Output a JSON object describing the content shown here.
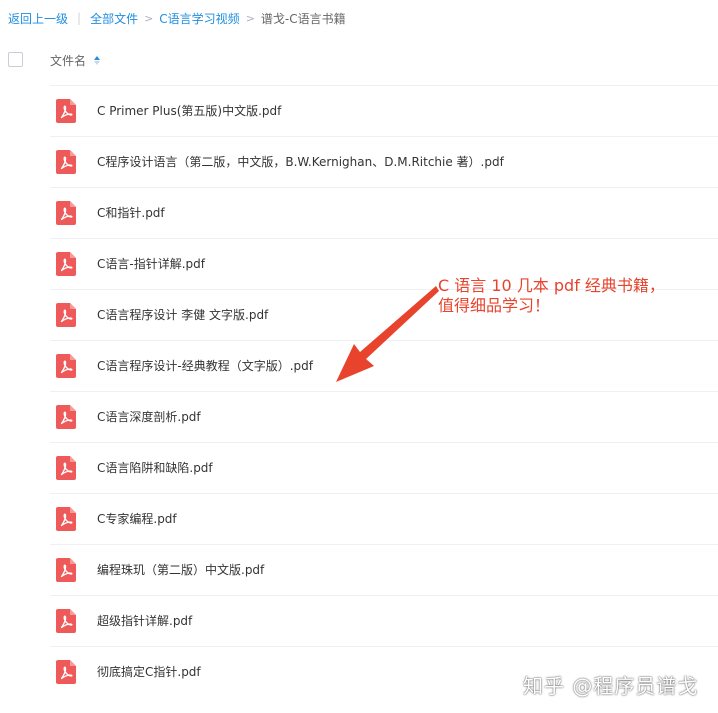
{
  "breadcrumb": {
    "back": "返回上一级",
    "separator": "|",
    "items": [
      "全部文件",
      "C语言学习视频"
    ],
    "current": "谱戈-C语言书籍"
  },
  "header": {
    "name_label": "文件名"
  },
  "files": [
    "C Primer Plus(第五版)中文版.pdf",
    "C程序设计语言（第二版，中文版，B.W.Kernighan、D.M.Ritchie 著）.pdf",
    "C和指针.pdf",
    "C语言-指针详解.pdf",
    "C语言程序设计 李健 文字版.pdf",
    "C语言程序设计-经典教程（文字版）.pdf",
    "C语言深度剖析.pdf",
    "C语言陷阱和缺陷.pdf",
    "C专家编程.pdf",
    "编程珠玑（第二版）中文版.pdf",
    "超级指针详解.pdf",
    "彻底搞定C指针.pdf"
  ],
  "annotation": {
    "line1": "C 语言 10 几本 pdf 经典书籍，",
    "line2": "值得细品学习！"
  },
  "watermark": "知乎 @程序员谱戈",
  "colors": {
    "link": "#1e8fe1",
    "pdf_icon": "#ee5a5a",
    "annotation": "#e8432d"
  },
  "icons": {
    "file": "pdf-icon",
    "sort": "sort-ascending-icon"
  }
}
